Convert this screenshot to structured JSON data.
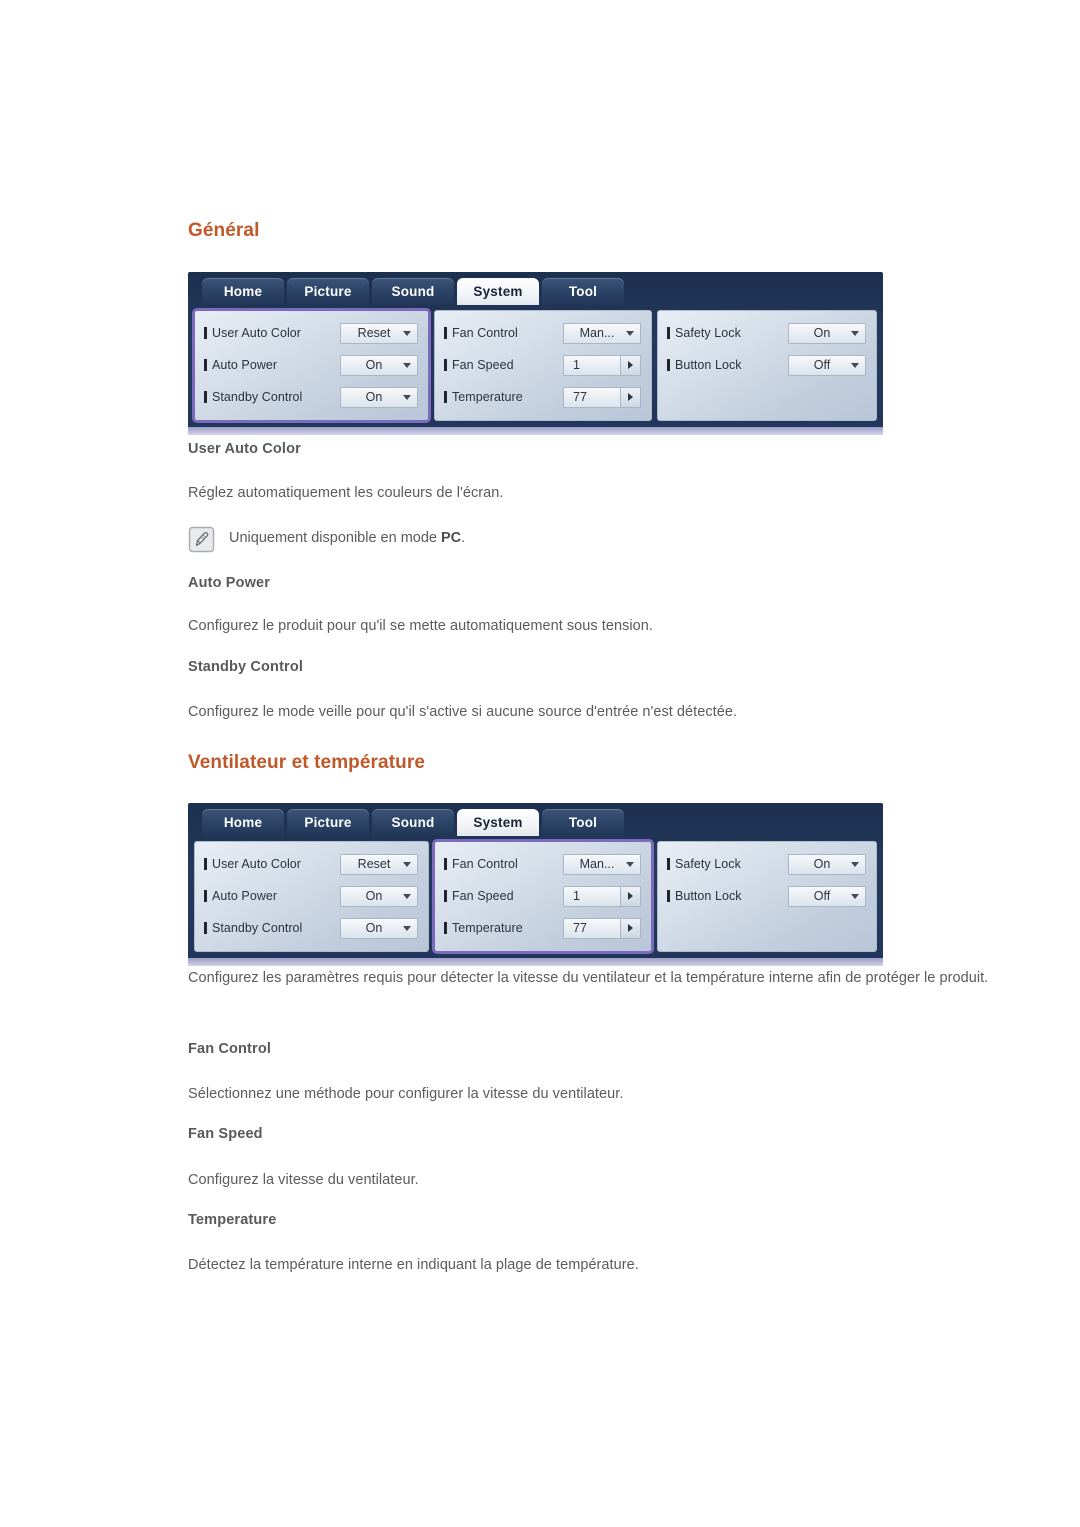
{
  "sections": {
    "general": {
      "heading": "Général",
      "items": [
        {
          "title": "User Auto Color",
          "text": "Réglez automatiquement les couleurs de l'écran."
        },
        {
          "title": "Auto Power",
          "text": "Configurez le produit pour qu'il se mette automatiquement sous tension."
        },
        {
          "title": "Standby Control",
          "text": "Configurez le mode veille pour qu'il s'active si aucune source d'entrée n'est détectée."
        }
      ],
      "note": {
        "icon": "note-pencil-icon",
        "text_before": "Uniquement disponible en mode ",
        "bold": "PC",
        "text_after": "."
      }
    },
    "fan": {
      "heading": "Ventilateur et température",
      "intro": "Configurez les paramètres requis pour détecter la vitesse du ventilateur et la température interne afin de protéger le produit.",
      "items": [
        {
          "title": "Fan Control",
          "text": "Sélectionnez une méthode pour configurer la vitesse du ventilateur."
        },
        {
          "title": "Fan Speed",
          "text": "Configurez la vitesse du ventilateur."
        },
        {
          "title": "Temperature",
          "text": "Détectez la température interne en indiquant la plage de température."
        }
      ]
    }
  },
  "osd": {
    "tabs": [
      {
        "label": "Home",
        "active": false
      },
      {
        "label": "Picture",
        "active": false
      },
      {
        "label": "Sound",
        "active": false
      },
      {
        "label": "System",
        "active": true
      },
      {
        "label": "Tool",
        "active": false
      }
    ],
    "columns": {
      "left": [
        {
          "label": "User Auto Color",
          "value": "Reset",
          "control": "dropdown"
        },
        {
          "label": "Auto Power",
          "value": "On",
          "control": "dropdown"
        },
        {
          "label": "Standby Control",
          "value": "On",
          "control": "dropdown"
        }
      ],
      "middle": [
        {
          "label": "Fan Control",
          "value": "Man...",
          "control": "dropdown"
        },
        {
          "label": "Fan Speed",
          "value": "1",
          "control": "stepper"
        },
        {
          "label": "Temperature",
          "value": "77",
          "control": "stepper"
        }
      ],
      "right": [
        {
          "label": "Safety Lock",
          "value": "On",
          "control": "dropdown"
        },
        {
          "label": "Button Lock",
          "value": "Off",
          "control": "dropdown"
        }
      ]
    },
    "highlight_first": "left",
    "highlight_second": "middle"
  },
  "colors": {
    "heading": "#c0582a",
    "body_text": "#5a5b5d",
    "highlight_outline": "#7b6bbd",
    "osd_header": "#22355a"
  }
}
